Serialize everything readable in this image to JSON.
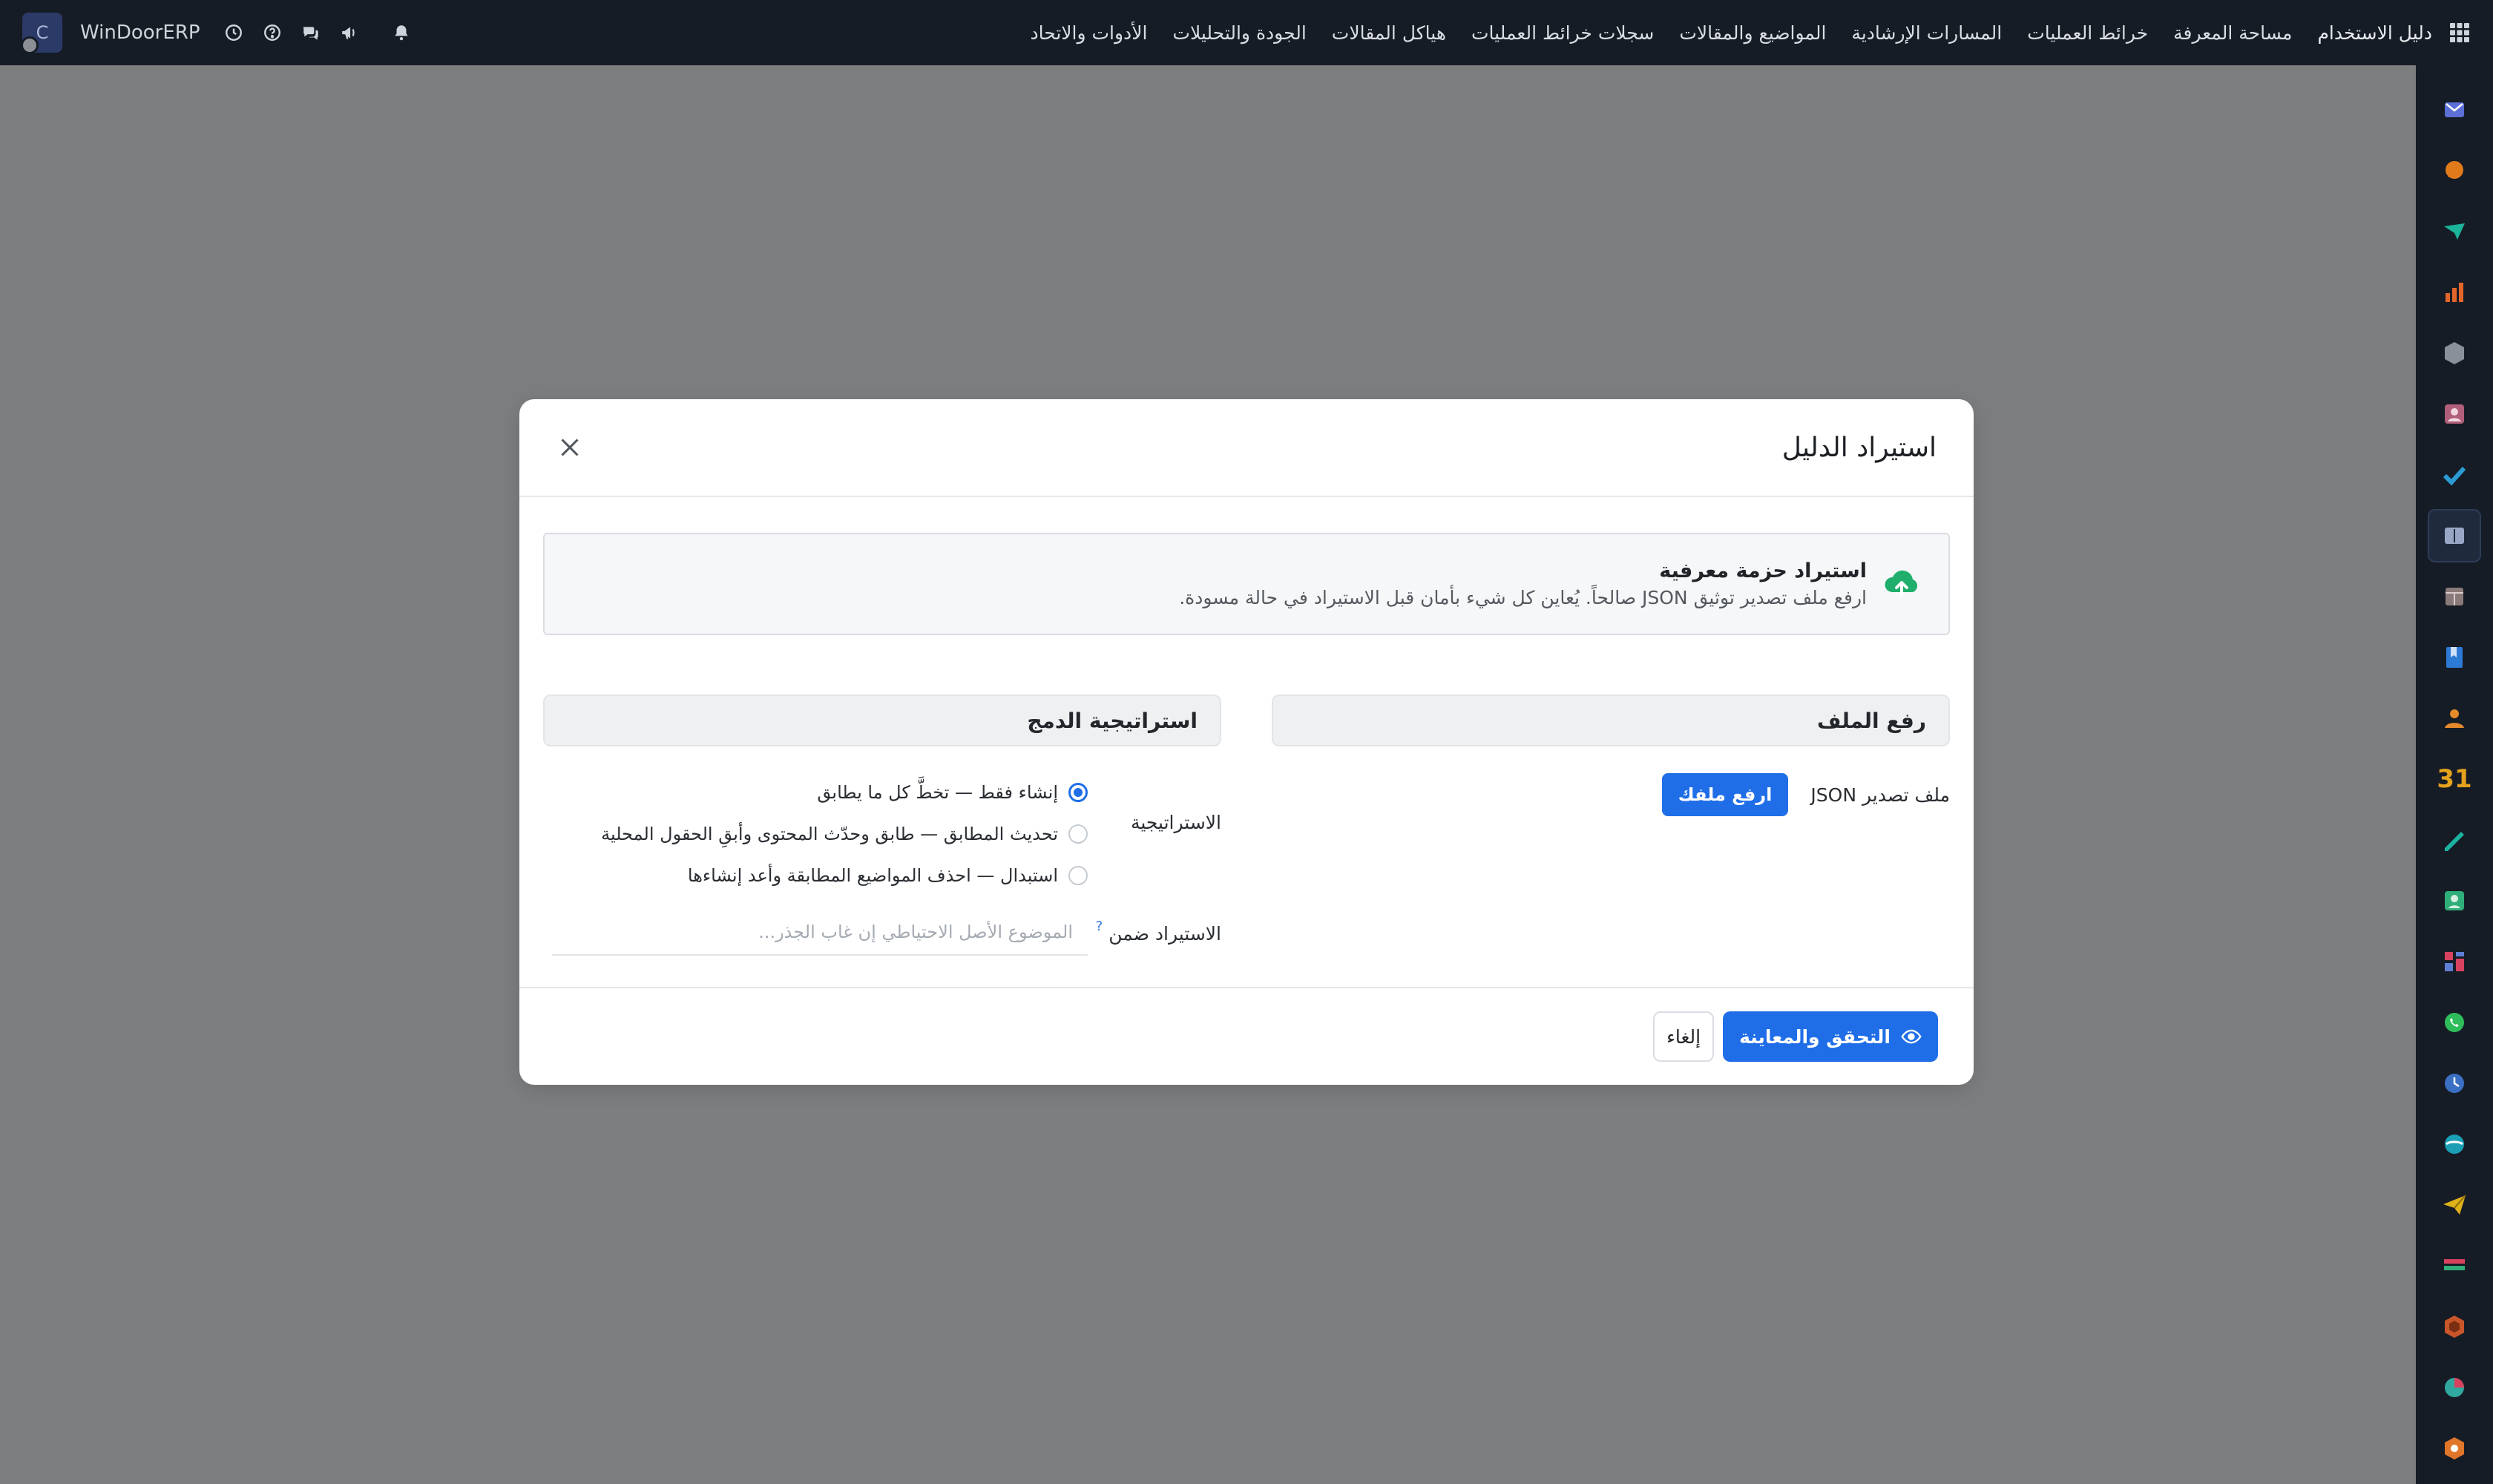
{
  "topbar": {
    "menu": [
      "دليل الاستخدام",
      "مساحة المعرفة",
      "خرائط العمليات",
      "المسارات الإرشادية",
      "المواضيع والمقالات",
      "سجلات خرائط العمليات",
      "هياكل المقالات",
      "الجودة والتحليلات",
      "الأدوات والاتحاد"
    ],
    "company": "WinDoorERP",
    "avatar_initial": "C",
    "icons": [
      "apps-grid-icon",
      "clock-icon",
      "help-icon",
      "chat-icon",
      "megaphone-icon",
      "bell-icon"
    ]
  },
  "rail": {
    "apps": [
      {
        "name": "mail-app-icon",
        "color": "#5b6fd6"
      },
      {
        "name": "chat-bubble-app-icon",
        "color": "#e07a1a"
      },
      {
        "name": "send-app-icon",
        "color": "#1bb39a"
      },
      {
        "name": "chart-app-icon",
        "color": "#e2662a"
      },
      {
        "name": "cube-app-icon",
        "color": "#8a9099"
      },
      {
        "name": "contacts-app-icon",
        "color": "#b05e7a"
      },
      {
        "name": "check-app-icon",
        "color": "#2b9bd6"
      },
      {
        "name": "knowledge-app-icon",
        "color": "#9aa7c4"
      },
      {
        "name": "package-app-icon",
        "color": "#8b7a7a"
      },
      {
        "name": "book-app-icon",
        "color": "#2d7ad6"
      },
      {
        "name": "people-app-icon",
        "color": "#e48a2a"
      },
      {
        "name": "calendar-app-icon",
        "color": "#e4a21c",
        "label": "31"
      },
      {
        "name": "sign-app-icon",
        "color": "#1bb3a0"
      },
      {
        "name": "employee-app-icon",
        "color": "#2fae7a"
      },
      {
        "name": "dashboard-app-icon",
        "color": "#d8425e"
      },
      {
        "name": "whatsapp-app-icon",
        "color": "#2ebd5a"
      },
      {
        "name": "clock-app-icon",
        "color": "#3a6fc4"
      },
      {
        "name": "sync-app-icon",
        "color": "#1a9fb4"
      },
      {
        "name": "paper-plane-app-icon",
        "color": "#e0b21a"
      },
      {
        "name": "table-app-icon",
        "color": "#d8425e"
      },
      {
        "name": "hexagon-app-icon",
        "color": "#c9562a"
      },
      {
        "name": "pie-app-icon",
        "color": "#2fa8a0"
      },
      {
        "name": "hex-box-app-icon",
        "color": "#e0762a"
      }
    ],
    "active_index": 7
  },
  "modal": {
    "title": "استيراد الدليل",
    "banner": {
      "title": "استيراد حزمة معرفية",
      "subtitle": "ارفع ملف تصدير توثيق JSON صالحاً. يُعاين كل شيء بأمان قبل الاستيراد في حالة مسودة.",
      "icon": "cloud-upload-icon",
      "icon_color": "#1fae6b"
    },
    "upload_section": {
      "heading": "رفع الملف",
      "file_label": "ملف تصدير JSON",
      "upload_button": "ارفع ملفك"
    },
    "merge_section": {
      "heading": "استراتيجية الدمج",
      "strategy_label": "الاستراتيجية",
      "options": [
        {
          "label": "إنشاء فقط — تخطَّ كل ما يطابق",
          "checked": true
        },
        {
          "label": "تحديث المطابق — طابق وحدّث المحتوى وأبقِ الحقول المحلية",
          "checked": false
        },
        {
          "label": "استبدال — احذف المواضيع المطابقة وأعد إنشاءها",
          "checked": false
        }
      ],
      "import_under_label": "الاستيراد ضمن",
      "help_mark": "?",
      "import_under_placeholder": "الموضوع الأصل الاحتياطي إن غاب الجذر..."
    },
    "footer": {
      "primary": "التحقق والمعاينة",
      "secondary": "إلغاء"
    },
    "accent": "#1f6ee8"
  }
}
